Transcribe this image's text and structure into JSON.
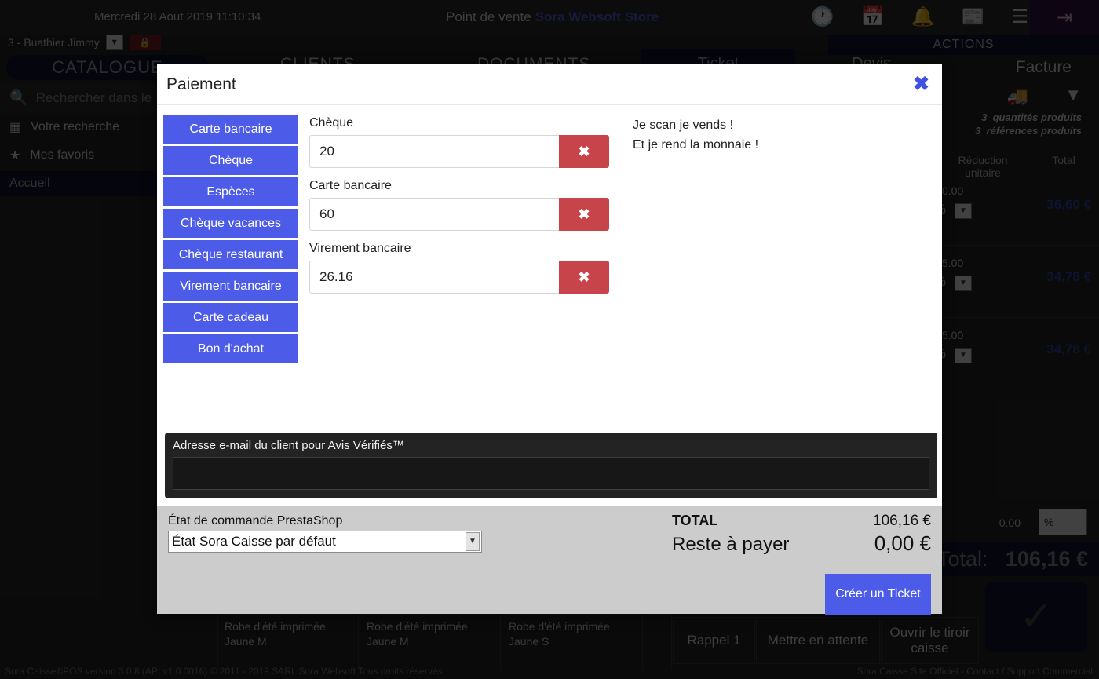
{
  "background": {
    "datetime": "Mercredi 28 Aout 2019 11:10:34",
    "pos_prefix": "Point de vente",
    "store_name": "Sora Websoft Store",
    "icons": [
      "clock-icon",
      "calendar-icon",
      "bell-icon",
      "newspaper-icon",
      "list-icon",
      "logout-icon"
    ],
    "actions_label": "ACTIONS",
    "user_select": "3 - Buathier Jimmy",
    "lock_icon": "lock-icon",
    "catalogue_label": "CATALOGUE",
    "tabs": [
      "CLIENTS",
      "DOCUMENTS",
      "Ticket",
      "Devis"
    ],
    "facture_label": "Facture",
    "search_placeholder": "Rechercher dans le",
    "menu_items": [
      "Votre recherche",
      "Mes favoris"
    ],
    "accueil_label": "Accueil",
    "truck_icon": "truck-icon",
    "chevron_icon": "chevron-down-icon",
    "qty_count": "3",
    "qty_label": "quantités produits",
    "ref_count": "3",
    "ref_label": "références produits",
    "col_reduction": "Réduction unitaire",
    "col_total": "Total",
    "rows": [
      {
        "discount": "0.00",
        "unit": "%",
        "total": "36,60 €"
      },
      {
        "discount": "5.00",
        "unit": "%",
        "total": "34,78 €"
      },
      {
        "discount": "5.00",
        "unit": "%",
        "total": "34,78 €"
      }
    ],
    "last_discount": "0.00",
    "last_unit": "%",
    "total_label": "Total:",
    "total_value": "106,16 €",
    "validate_icon": "check-icon",
    "products": [
      "Robe d'été imprimée Jaune M",
      "Robe d'été imprimée Jaune M",
      "Robe d'été imprimée Jaune S"
    ],
    "action_buttons": [
      "Rappel 1",
      "Mettre en attente",
      "Ouvrir le tiroir caisse"
    ],
    "footer_left": "Sora Caisse®POS version 3.0.8 (API v1.0.0016) © 2011 - 2019 SARL Sora Websoft Tous droits réservés",
    "footer_right": "Sora Caisse Site Officiel - Contact / Support Commercial"
  },
  "modal": {
    "title": "Paiement",
    "close_icon": "close-icon",
    "payment_methods": [
      "Carte bancaire",
      "Chèque",
      "Espèces",
      "Chèque vacances",
      "Chèque restaurant",
      "Virement bancaire",
      "Carte cadeau",
      "Bon d'achat"
    ],
    "payment_lines": [
      {
        "label": "Chèque",
        "amount": "20",
        "delete_icon": "close-icon"
      },
      {
        "label": "Carte bancaire",
        "amount": "60",
        "delete_icon": "close-icon"
      },
      {
        "label": "Virement bancaire",
        "amount": "26.16",
        "delete_icon": "close-icon"
      }
    ],
    "note_line1": "Je scan je vends !",
    "note_line2": "Et je rend la monnaie !",
    "email_label": "Adresse e-mail du client pour Avis Vérifiés™",
    "email_value": "",
    "email_placeholder": "",
    "prestashop_label": "État de commande PrestaShop",
    "prestashop_value": "État Sora Caisse par défaut",
    "total_label": "TOTAL",
    "total_value": "106,16 €",
    "remaining_label": "Reste à payer",
    "remaining_value": "0,00 €",
    "create_ticket_label": "Créer un Ticket"
  },
  "colors": {
    "accent_blue": "#4c5ce8",
    "danger_red": "#c6444a",
    "footer_gray": "#cccccc",
    "dark_panel": "#232323"
  }
}
